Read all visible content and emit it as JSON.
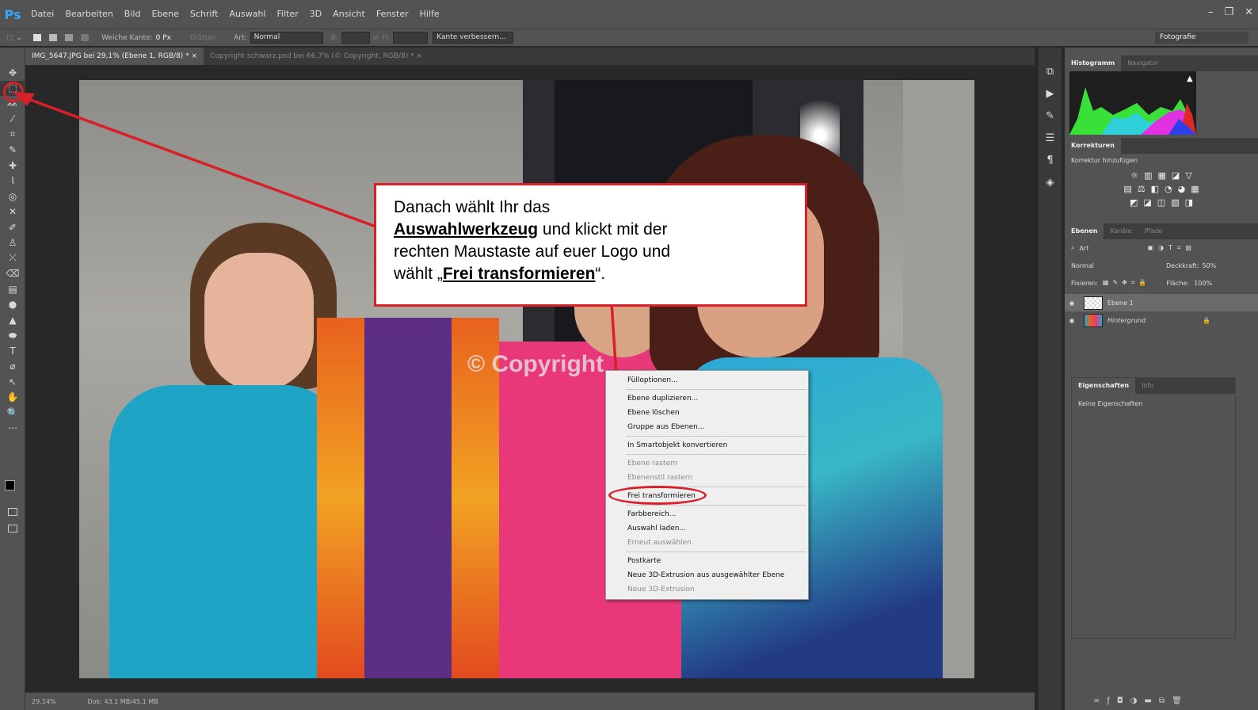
{
  "app": {
    "logo": "Ps"
  },
  "menubar": {
    "items": [
      "Datei",
      "Bearbeiten",
      "Bild",
      "Ebene",
      "Schrift",
      "Auswahl",
      "Filter",
      "3D",
      "Ansicht",
      "Fenster",
      "Hilfe"
    ],
    "minimize": "–",
    "restore": "❐",
    "close": "✕"
  },
  "options": {
    "feather_label": "Weiche Kante:",
    "feather_value": "0 Px",
    "smooth_label": "Glätten",
    "style_label": "Art:",
    "style_value": "Normal",
    "width_label": "B:",
    "height_label": "H:",
    "refine_label": "Kante verbessern...",
    "workspace": "Fotografie"
  },
  "tabs": [
    {
      "label": "IMG_5647.JPG bei 29,1% (Ebene 1, RGB/8) *",
      "active": true
    },
    {
      "label": "Copyright schwarz.psd bei 66,7% (© Copyright, RGB/8) *",
      "active": false
    }
  ],
  "tab_close": "×",
  "tools": [
    "✥",
    "⬚",
    "ᨐ",
    "⁄",
    "⌗",
    "✎",
    "✚",
    "⌇",
    "◎",
    "✕",
    "✐",
    "♙",
    "⤫",
    "⌫",
    "▤",
    "●",
    "▲",
    "⬬",
    "T",
    "⌀",
    "↖",
    "✋",
    "🔍",
    "⋯"
  ],
  "canvas": {
    "watermark": "© Copyright"
  },
  "status": {
    "zoom": "29,14%",
    "doc": "Dok: 43,1 MB/45,1 MB"
  },
  "panels": {
    "histogram_tabs": [
      "Histogramm",
      "Navigator"
    ],
    "adjust_title": "Korrekturen",
    "adjust_add": "Korrektur hinzufügen",
    "adjust_rows": [
      [
        "☼",
        "▥",
        "▦",
        "◪",
        "▽"
      ],
      [
        "▤",
        "⚖",
        "◧",
        "◔",
        "◕",
        "▦"
      ],
      [
        "◩",
        "◪",
        "◫",
        "▧",
        "◨"
      ]
    ],
    "layers_tabs": [
      "Ebenen",
      "Kanäle",
      "Pfade"
    ],
    "layers_filter": "Art",
    "blend_mode": "Normal",
    "opacity_label": "Deckkraft:",
    "opacity_value": "50%",
    "lock_label": "Fixieren:",
    "fill_label": "Fläche:",
    "fill_value": "100%",
    "layers": [
      {
        "name": "Ebene 1",
        "italic": false
      },
      {
        "name": "Hintergrund",
        "italic": true
      }
    ],
    "props_tabs": [
      "Eigenschaften",
      "Info"
    ],
    "props_empty": "Keine Eigenschaften"
  },
  "context_menu": [
    {
      "label": "Fülloptionen...",
      "enabled": true
    },
    {
      "sep": true
    },
    {
      "label": "Ebene duplizieren...",
      "enabled": true
    },
    {
      "label": "Ebene löschen",
      "enabled": true
    },
    {
      "label": "Gruppe aus Ebenen...",
      "enabled": true
    },
    {
      "sep": true
    },
    {
      "label": "In Smartobjekt konvertieren",
      "enabled": true
    },
    {
      "sep": true
    },
    {
      "label": "Ebene rastern",
      "enabled": false
    },
    {
      "label": "Ebenenstil rastern",
      "enabled": false
    },
    {
      "sep": true
    },
    {
      "label": "Frei transformieren",
      "enabled": true
    },
    {
      "sep": true
    },
    {
      "label": "Farbbereich...",
      "enabled": true
    },
    {
      "label": "Auswahl laden...",
      "enabled": true
    },
    {
      "label": "Erneut auswählen",
      "enabled": false
    },
    {
      "sep": true
    },
    {
      "label": "Postkarte",
      "enabled": true
    },
    {
      "label": "Neue 3D-Extrusion aus ausgewählter Ebene",
      "enabled": true
    },
    {
      "label": "Neue 3D-Extrusion",
      "enabled": false
    }
  ],
  "callout": {
    "line1": "Danach wählt Ihr das",
    "tool_name": "Auswahlwerkzeug",
    "line2_rest": " und klickt mit der",
    "line3": "rechten Maustaste auf euer Logo und",
    "line4_pre": "wählt „",
    "action": "Frei transformieren",
    "line4_post": "“."
  },
  "colors": {
    "accent": "#d8202a",
    "ps_blue": "#31a8ff",
    "ui_bg": "#535353"
  }
}
